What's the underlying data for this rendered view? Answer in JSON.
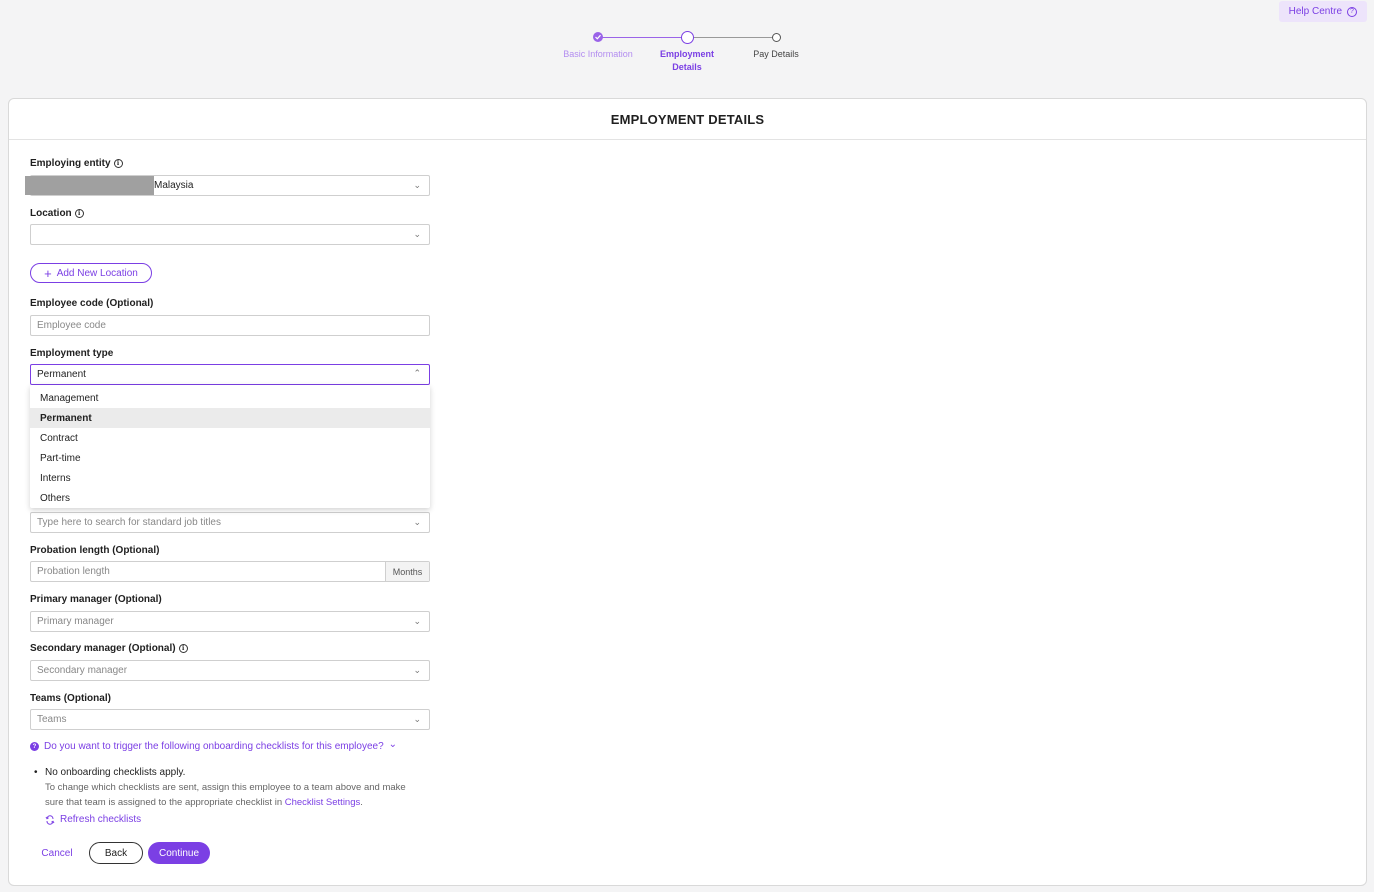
{
  "help": {
    "label": "Help Centre"
  },
  "stepper": {
    "steps": [
      {
        "label": "Basic Information",
        "state": "done"
      },
      {
        "label": "Employment Details",
        "state": "current"
      },
      {
        "label": "Pay Details",
        "state": "upcoming"
      }
    ]
  },
  "page": {
    "title": "EMPLOYMENT DETAILS"
  },
  "form": {
    "employing_entity": {
      "label": "Employing entity",
      "value": "Malaysia"
    },
    "location": {
      "label": "Location",
      "value": ""
    },
    "add_location": {
      "label": "Add New Location"
    },
    "employee_code": {
      "label": "Employee code (Optional)",
      "placeholder": "Employee code"
    },
    "employment_type": {
      "label": "Employment type",
      "value": "Permanent",
      "options": [
        "Management",
        "Permanent",
        "Contract",
        "Part-time",
        "Interns",
        "Others"
      ],
      "selected": "Permanent"
    },
    "job_title": {
      "placeholder": "Type here to search for standard job titles"
    },
    "probation": {
      "label": "Probation length (Optional)",
      "placeholder": "Probation length",
      "suffix": "Months"
    },
    "primary_manager": {
      "label": "Primary manager (Optional)",
      "placeholder": "Primary manager"
    },
    "secondary_manager": {
      "label": "Secondary manager (Optional)",
      "placeholder": "Secondary manager"
    },
    "teams": {
      "label": "Teams (Optional)",
      "placeholder": "Teams"
    }
  },
  "checklists": {
    "question": "Do you want to trigger the following onboarding checklists for this employee?",
    "bullet": "No onboarding checklists apply.",
    "note_prefix": "To change which checklists are sent, assign this employee to a team above and make sure that team is assigned to the appropriate checklist in",
    "note_link": "Checklist Settings",
    "note_suffix": ".",
    "refresh": "Refresh checklists"
  },
  "actions": {
    "cancel": "Cancel",
    "back": "Back",
    "continue": "Continue"
  },
  "colors": {
    "accent": "#7b3fe4",
    "step_done": "#9a63e8",
    "redaction": "#a0a0a0"
  }
}
